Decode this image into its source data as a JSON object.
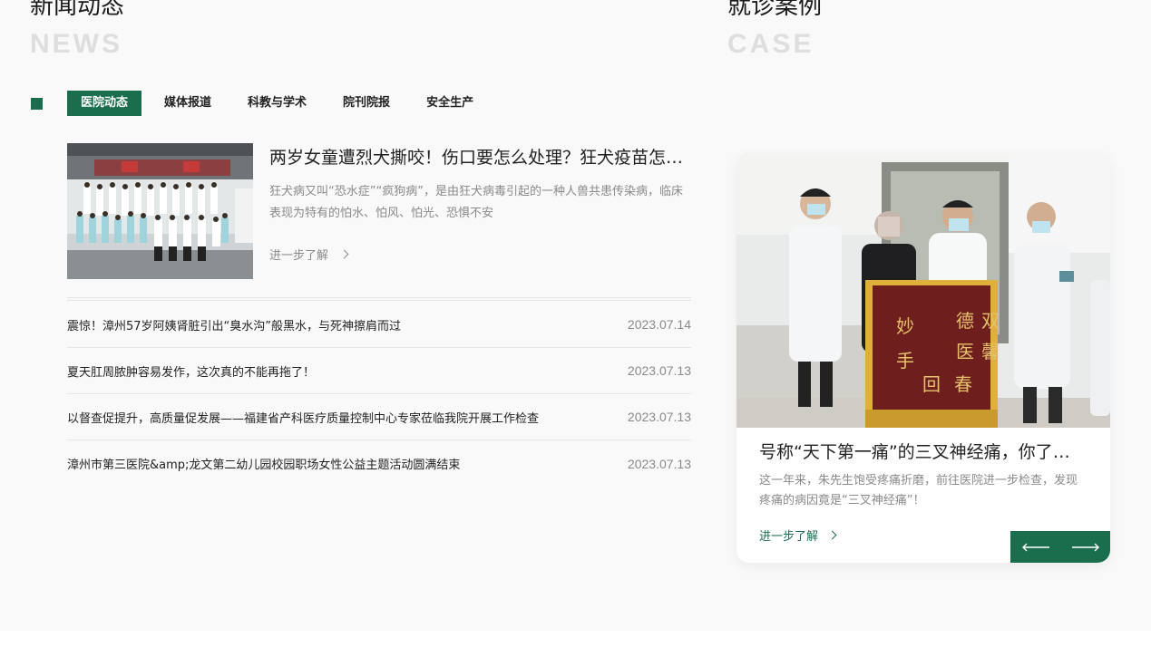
{
  "news": {
    "title": "新闻动态",
    "subtitle": "NEWS",
    "tabs": [
      {
        "label": "医院动态",
        "active": true
      },
      {
        "label": "媒体报道",
        "active": false
      },
      {
        "label": "科教与学术",
        "active": false
      },
      {
        "label": "院刊院报",
        "active": false
      },
      {
        "label": "安全生产",
        "active": false
      }
    ],
    "featured": {
      "title": "两岁女童遭烈犬撕咬！伤口要怎么处理？狂犬疫苗怎么打？",
      "description": "狂犬病又叫“恐水症”“疯狗病”，是由狂犬病毒引起的一种人兽共患传染病，临床表现为特有的怕水、怕风、怕光、恐惧不安",
      "more_label": "进一步了解",
      "image": "group-photo"
    },
    "items": [
      {
        "text": "震惊！漳州57岁阿姨肾脏引出“臭水沟”般黑水，与死神擦肩而过",
        "date": "2023.07.14"
      },
      {
        "text": "夏天肛周脓肿容易发作，这次真的不能再拖了！",
        "date": "2023.07.13"
      },
      {
        "text": "以督查促提升，高质量促发展——福建省产科医疗质量控制中心专家莅临我院开展工作检查",
        "date": "2023.07.13"
      },
      {
        "text": "漳州市第三医院&amp;龙文第二幼儿园校园职场女性公益主题活动圆满结束",
        "date": "2023.07.13"
      }
    ]
  },
  "case": {
    "title": "就诊案例",
    "subtitle": "CASE",
    "card": {
      "title": "号称“天下第一痛”的三叉神经痛，你了解多少？",
      "description": "这一年来，朱先生饱受疼痛折磨，前往医院进一步检查，发现疼痛的病因竟是“三叉神经痛”！",
      "more_label": "进一步了解",
      "image": "doctors-with-banner",
      "banner_text": "德医双馨 妙手回春"
    },
    "nav": {
      "prev_icon": "arrow-left-icon",
      "next_icon": "arrow-right-icon"
    }
  },
  "colors": {
    "accent": "#1a6e4e",
    "muted_text": "#8a8a8a",
    "heading_sub": "#dedede",
    "background": "#f9f9f9"
  }
}
